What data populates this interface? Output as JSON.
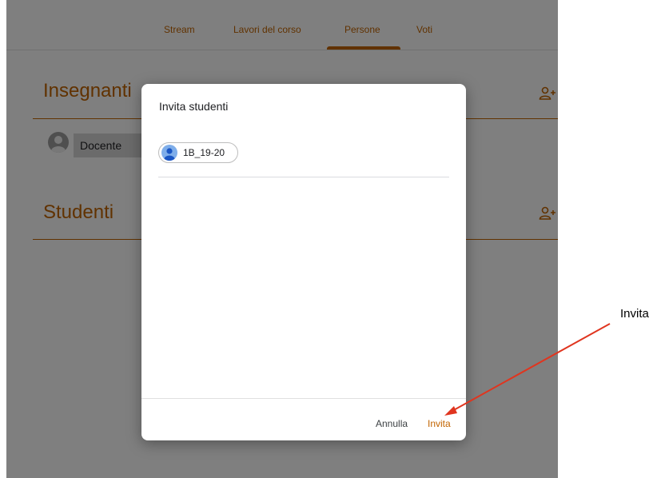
{
  "tabs": [
    {
      "label": "Stream"
    },
    {
      "label": "Lavori del corso"
    },
    {
      "label": "Persone",
      "active": true
    },
    {
      "label": "Voti"
    }
  ],
  "sections": {
    "teachers_title": "Insegnanti",
    "students_title": "Studenti"
  },
  "teacher": {
    "name": "Docente"
  },
  "dialog": {
    "title": "Invita studenti",
    "chip_label": "1B_19-20",
    "cancel_label": "Annulla",
    "invite_label": "Invita"
  },
  "annotation": {
    "label": "Invita"
  },
  "colors": {
    "accent": "#c26401",
    "annotation_arrow": "#e0351f"
  }
}
